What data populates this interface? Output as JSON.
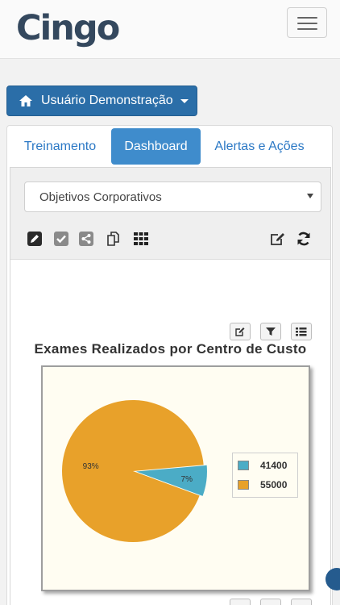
{
  "navbar": {
    "brand": "Cingo"
  },
  "user_button": {
    "label": "Usuário Demonstração"
  },
  "tabs": [
    {
      "label": "Treinamento"
    },
    {
      "label": "Dashboard"
    },
    {
      "label": "Alertas e Ações"
    }
  ],
  "selector": {
    "selected": "Objetivos Corporativos"
  },
  "toolbar_icons": [
    "pencil-icon",
    "check-icon",
    "share-icon",
    "copy-icon",
    "grid-icon",
    "edit-icon",
    "refresh-icon"
  ],
  "chart_buttons": [
    "edit-icon",
    "filter-icon",
    "list-icon"
  ],
  "colors": {
    "primary": "#2b6ea8",
    "tab_active": "#3f8ccc",
    "series_orange": "#e8a12a",
    "series_teal": "#4bacc6"
  },
  "chart_data": {
    "type": "pie",
    "title": "Exames Realizados por Centro de Custo",
    "slices": [
      {
        "name": "41400",
        "percent": 7,
        "label": "7%",
        "color": "#4bacc6"
      },
      {
        "name": "55000",
        "percent": 93,
        "label": "93%",
        "color": "#e8a12a"
      }
    ],
    "legend_position": "right"
  }
}
